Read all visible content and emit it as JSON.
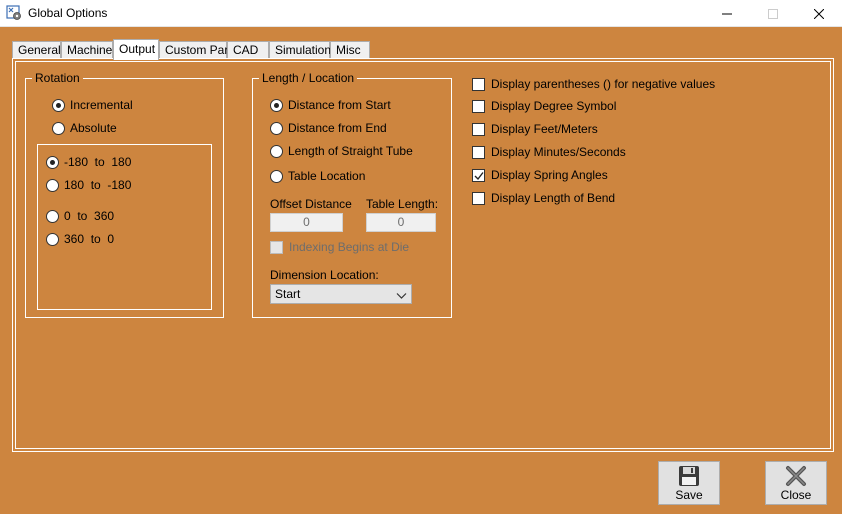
{
  "window": {
    "title": "Global Options",
    "icon": "settings-app-icon"
  },
  "tabs": [
    {
      "label": "General"
    },
    {
      "label": "Machine"
    },
    {
      "label": "Output",
      "active": true
    },
    {
      "label": "Custom Part"
    },
    {
      "label": "CAD"
    },
    {
      "label": "Simulation"
    },
    {
      "label": "Misc"
    }
  ],
  "rotation": {
    "legend": "Rotation",
    "modes": [
      {
        "label": "Incremental",
        "checked": true
      },
      {
        "label": "Absolute",
        "checked": false
      }
    ],
    "ranges": [
      {
        "label": "-180  to  180",
        "checked": true
      },
      {
        "label": "180  to  -180",
        "checked": false
      },
      {
        "label": "0  to  360",
        "checked": false
      },
      {
        "label": "360  to  0",
        "checked": false
      }
    ]
  },
  "length_location": {
    "legend": "Length / Location",
    "options": [
      {
        "label": "Distance from Start",
        "checked": true
      },
      {
        "label": "Distance from End",
        "checked": false
      },
      {
        "label": "Length of Straight Tube",
        "checked": false
      },
      {
        "label": "Table Location",
        "checked": false
      }
    ],
    "offset_distance": {
      "label": "Offset Distance",
      "value": "0"
    },
    "table_length": {
      "label": "Table Length:",
      "value": "0"
    },
    "indexing": {
      "label": "Indexing Begins at Die",
      "checked": false,
      "enabled": false
    },
    "dimension_location": {
      "label": "Dimension Location:",
      "value": "Start"
    }
  },
  "display_options": [
    {
      "label": "Display parentheses () for negative values",
      "checked": false
    },
    {
      "label": "Display Degree Symbol",
      "checked": false
    },
    {
      "label": "Display Feet/Meters",
      "checked": false
    },
    {
      "label": "Display Minutes/Seconds",
      "checked": false
    },
    {
      "label": "Display Spring Angles",
      "checked": true
    },
    {
      "label": "Display Length of Bend",
      "checked": false
    }
  ],
  "buttons": {
    "save": {
      "label": "Save",
      "icon": "floppy-disk-icon"
    },
    "close": {
      "label": "Close",
      "icon": "close-x-icon"
    }
  },
  "colors": {
    "background": "#cd853f",
    "border": "#ffffff"
  }
}
